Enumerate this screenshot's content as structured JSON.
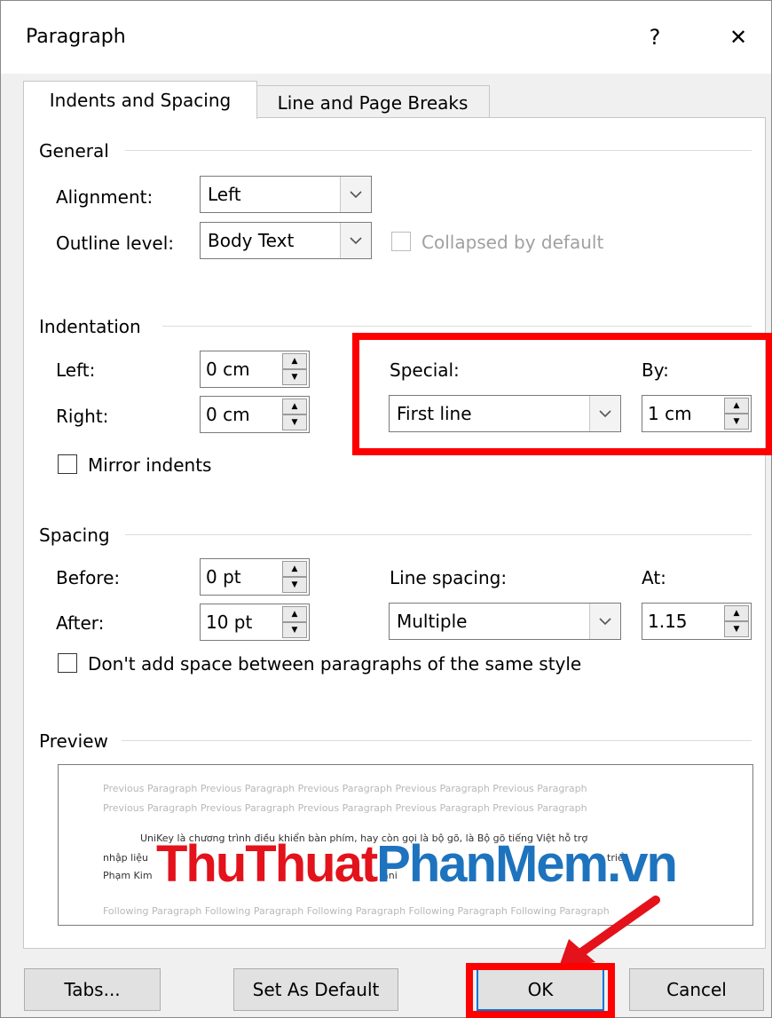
{
  "window": {
    "title": "Paragraph",
    "help": "?",
    "close": "✕"
  },
  "tabs": [
    {
      "label": "Indents and Spacing",
      "active": true
    },
    {
      "label": "Line and Page Breaks",
      "active": false
    }
  ],
  "general": {
    "heading": "General",
    "alignment_label": "Alignment:",
    "alignment_value": "Left",
    "outline_label": "Outline level:",
    "outline_value": "Body Text",
    "collapsed_label": "Collapsed by default"
  },
  "indentation": {
    "heading": "Indentation",
    "left_label": "Left:",
    "left_value": "0 cm",
    "right_label": "Right:",
    "right_value": "0 cm",
    "special_label": "Special:",
    "special_value": "First line",
    "by_label": "By:",
    "by_value": "1 cm",
    "mirror_label": "Mirror indents"
  },
  "spacing": {
    "heading": "Spacing",
    "before_label": "Before:",
    "before_value": "0 pt",
    "after_label": "After:",
    "after_value": "10 pt",
    "line_spacing_label": "Line spacing:",
    "line_spacing_value": "Multiple",
    "at_label": "At:",
    "at_value": "1.15",
    "dont_add_label": "Don't add space between paragraphs of the same style"
  },
  "preview": {
    "heading": "Preview",
    "prev1": "Previous Paragraph Previous Paragraph Previous Paragraph Previous Paragraph Previous Paragraph",
    "prev2": "Previous Paragraph Previous Paragraph Previous Paragraph Previous Paragraph Previous Paragraph",
    "text1": "UniKey là chương trình điều khiển bàn phím, hay còn gọi là bộ gõ, là Bộ gõ tiếng Việt hỗ trợ",
    "text2a": "nhập liệu",
    "text2b": "triể",
    "text3a": "Phạm Kim",
    "text3b": "ani",
    "follow1": "Following Paragraph Following Paragraph Following Paragraph Following Paragraph Following Paragraph",
    "watermark_part1": "ThuThuat",
    "watermark_part2": "PhanMem",
    "watermark_part3": ".vn"
  },
  "buttons": {
    "tabs": "Tabs...",
    "set_default": "Set As Default",
    "ok": "OK",
    "cancel": "Cancel"
  },
  "colors": {
    "highlight": "#ff0000",
    "watermark_red": "#e3121b",
    "watermark_blue": "#1e73be"
  }
}
